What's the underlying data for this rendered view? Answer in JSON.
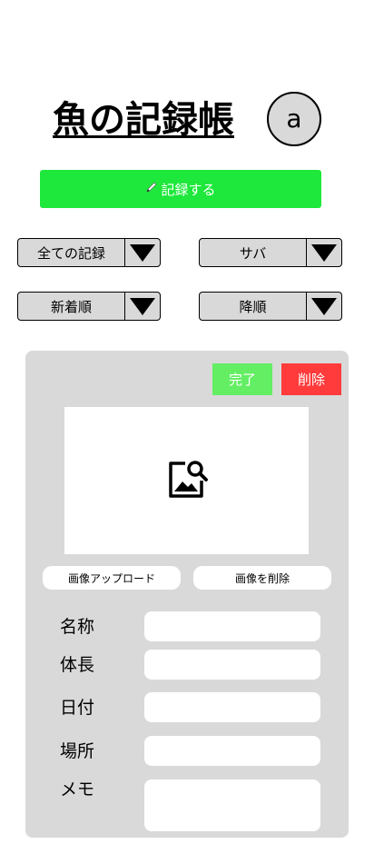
{
  "header": {
    "title": "魚の記録帳",
    "avatar_letter": "a"
  },
  "actions": {
    "record_icon": "pencil-icon",
    "record_label": "記録する"
  },
  "filters": [
    {
      "value": "全ての記録"
    },
    {
      "value": "サバ"
    },
    {
      "value": "新着順"
    },
    {
      "value": "降順"
    }
  ],
  "card": {
    "done_label": "完了",
    "delete_label": "削除",
    "image_icon": "image-search-icon",
    "upload_label": "画像アップロード",
    "remove_image_label": "画像を削除",
    "fields": [
      {
        "label": "名称",
        "value": ""
      },
      {
        "label": "体長",
        "value": ""
      },
      {
        "label": "日付",
        "value": ""
      },
      {
        "label": "場所",
        "value": ""
      },
      {
        "label": "メモ",
        "value": ""
      }
    ]
  },
  "colors": {
    "record_button": "#1ee83b",
    "done_button": "#63ee63",
    "delete_button": "#ff3b3b",
    "card_background": "#d9d9d9"
  }
}
